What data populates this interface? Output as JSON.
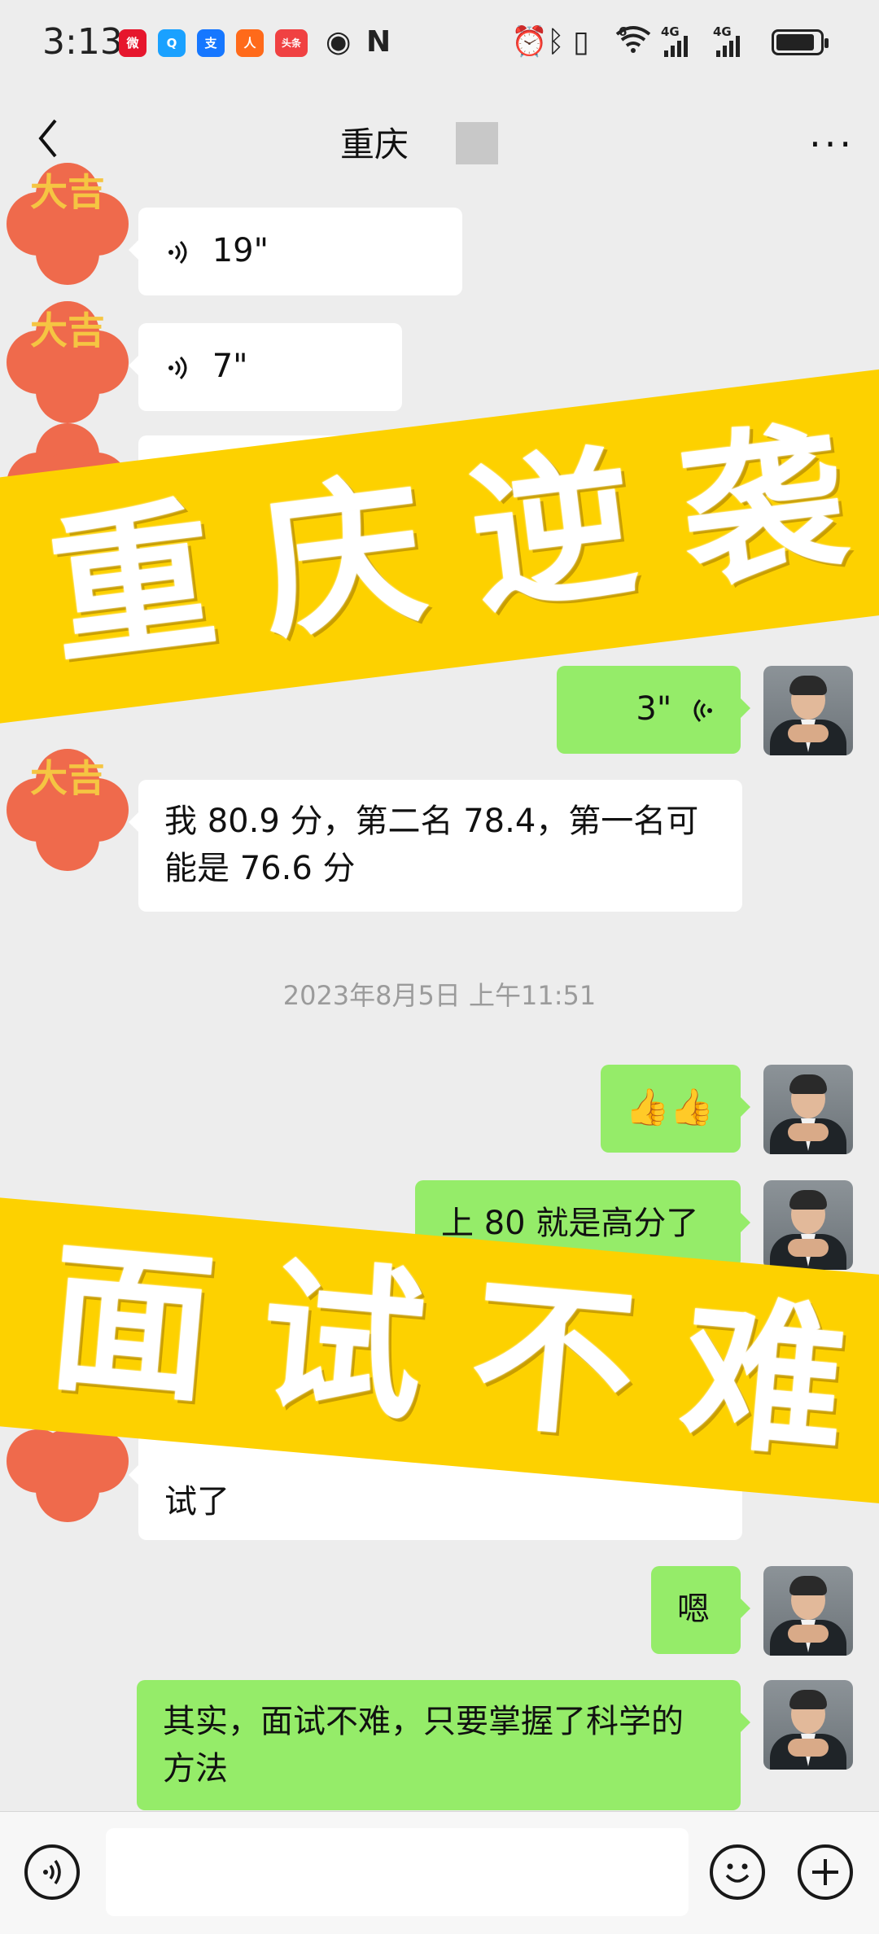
{
  "status_bar": {
    "time": "3:13",
    "apps": [
      {
        "name": "weibo-icon",
        "color": "#e6162d",
        "glyph": "微"
      },
      {
        "name": "qq-browser-icon",
        "color": "#1aa1ff",
        "glyph": "Q"
      },
      {
        "name": "alipay-icon",
        "color": "#1677ff",
        "glyph": "支"
      },
      {
        "name": "app-icon",
        "color": "#ff6a1a",
        "glyph": "人"
      },
      {
        "name": "toutiao-icon",
        "color": "#f04142",
        "glyph": "头条"
      }
    ],
    "net_label_1": "6",
    "net_label_2": "4G",
    "net_label_3": "4G"
  },
  "header": {
    "title": "重庆",
    "back_icon": "chevron-left-icon",
    "more_icon": "more-dots-icon"
  },
  "messages": [
    {
      "side": "in",
      "type": "voice",
      "text": "19\""
    },
    {
      "side": "in",
      "type": "voice",
      "text": "7\""
    },
    {
      "side": "out",
      "type": "voice",
      "text": "3\""
    },
    {
      "side": "in",
      "type": "text",
      "text": "我 80.9 分，第二名 78.4，第一名可能是 76.6 分"
    },
    {
      "side": "out",
      "type": "emoji",
      "text": "👍👍"
    },
    {
      "side": "out",
      "type": "text",
      "text": "上 80 就是高分了"
    },
    {
      "side": "in",
      "type": "text",
      "text": "试了"
    },
    {
      "side": "out",
      "type": "text",
      "text": "嗯"
    },
    {
      "side": "out",
      "type": "text",
      "text": "其实，面试不难，只要掌握了科学的方法"
    }
  ],
  "lucky_avatar_text": "大吉",
  "timestamp": "2023年8月5日 上午11:51",
  "banners": {
    "top": "重庆逆袭",
    "bottom": "面试不难"
  },
  "colors": {
    "background": "#ededed",
    "bubble_out": "#95ec69",
    "bubble_in": "#ffffff",
    "banner": "#fdd100",
    "lucky_badge": "#ef6a4c"
  },
  "bottom_bar": {
    "voice_icon": "voice-toggle-icon",
    "emoji_icon": "emoji-icon",
    "plus_icon": "plus-icon"
  }
}
